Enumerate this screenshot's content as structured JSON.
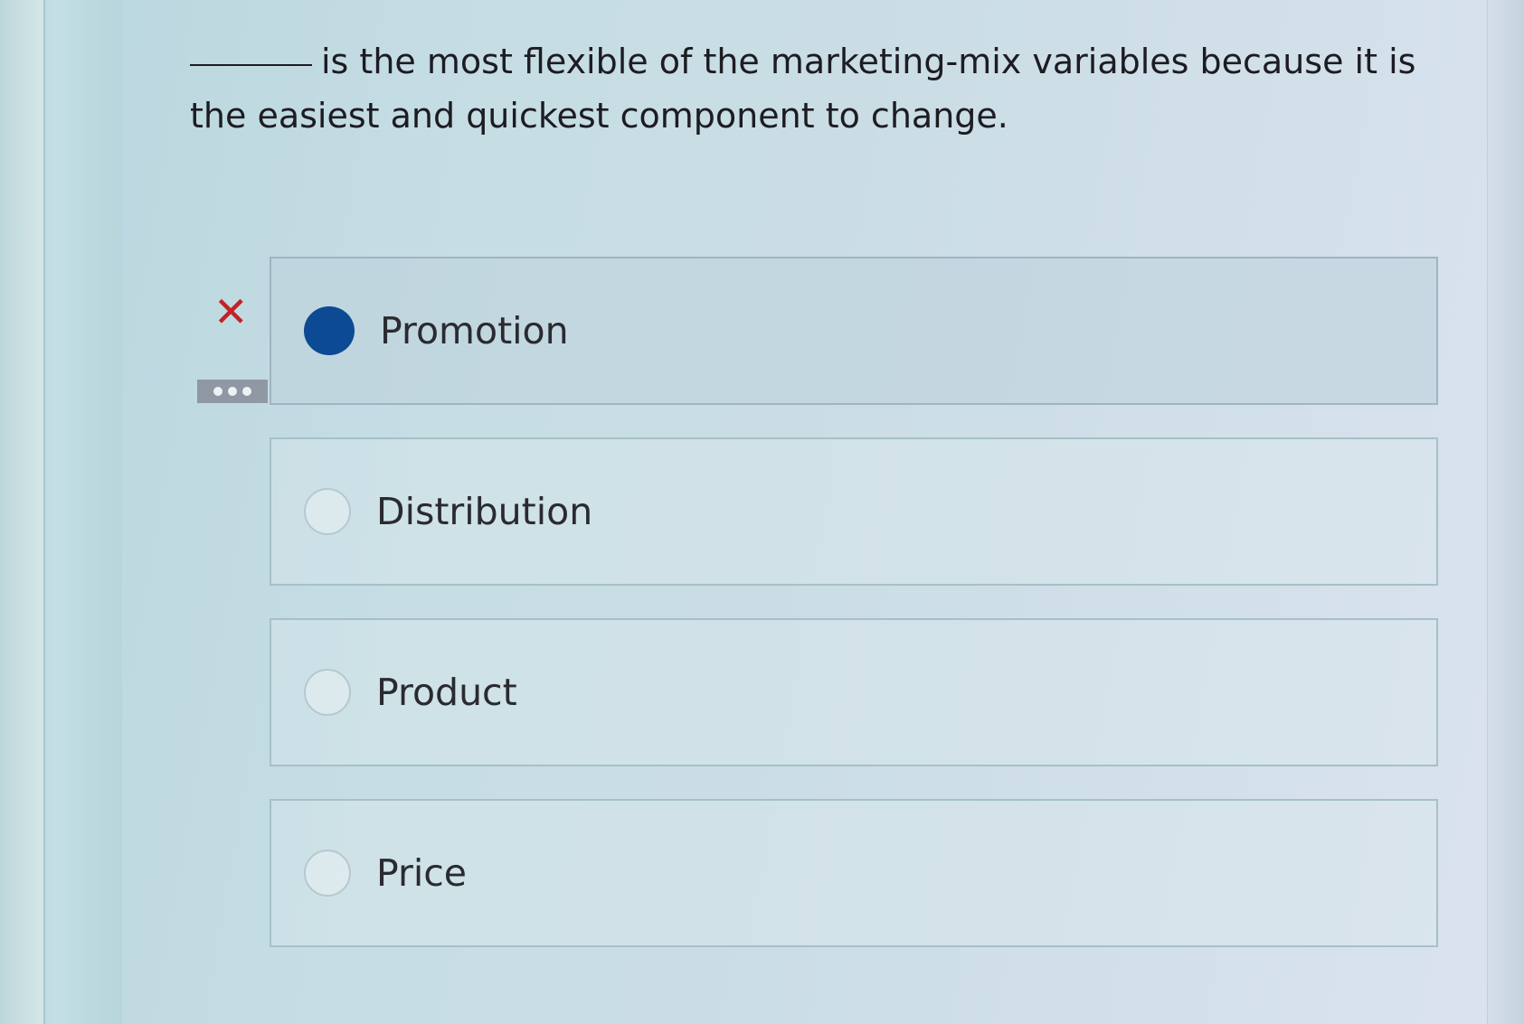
{
  "question": {
    "text": "is the most flexible of the marketing-mix variables because it is the easiest and quickest component to change."
  },
  "answer_status": {
    "icon": "x-mark-icon",
    "glyph": "✕",
    "color": "#c42225"
  },
  "options": [
    {
      "label": "Promotion",
      "selected": true
    },
    {
      "label": "Distribution",
      "selected": false
    },
    {
      "label": "Product",
      "selected": false
    },
    {
      "label": "Price",
      "selected": false
    }
  ],
  "colors": {
    "selected_radio": "#0d4a94",
    "incorrect": "#c42225"
  }
}
